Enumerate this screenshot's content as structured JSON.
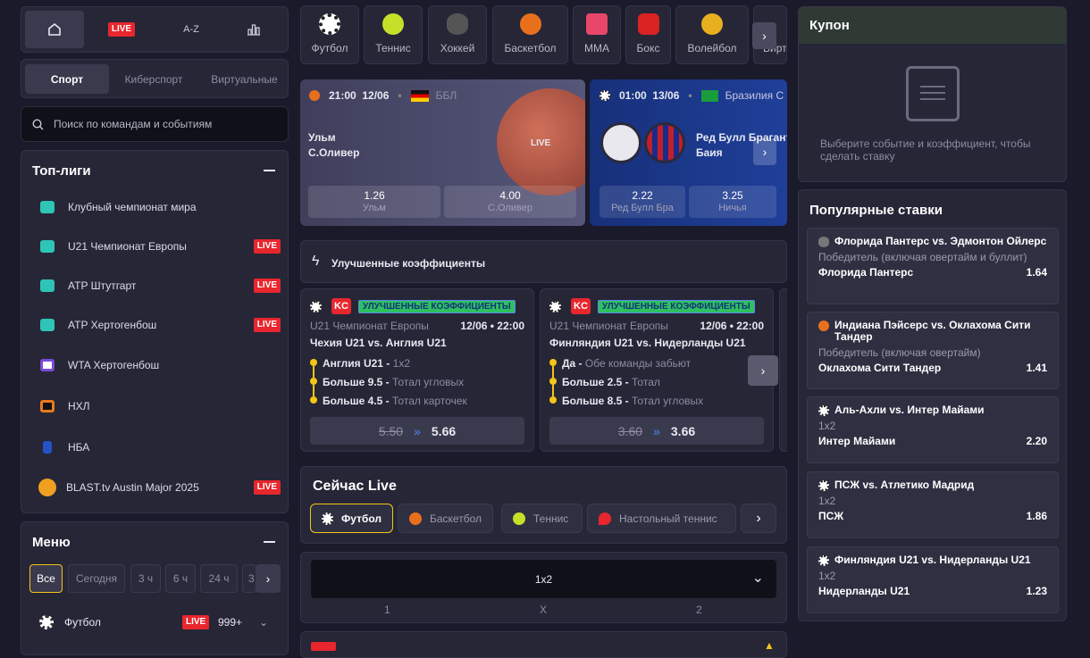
{
  "nav": {
    "live": "LIVE",
    "az": "A-Z"
  },
  "tabs": [
    "Спорт",
    "Киберспорт",
    "Виртуальные"
  ],
  "search": {
    "placeholder": "Поиск по командам и событиям"
  },
  "top_leagues": {
    "title": "Топ-лиги",
    "items": [
      {
        "name": "Клубный чемпионат мира",
        "live": false,
        "color": "#2ec4b6"
      },
      {
        "name": "U21 Чемпионат Европы",
        "live": true,
        "color": "#2ec4b6"
      },
      {
        "name": "ATP Штутгарт",
        "live": true,
        "color": "#2ec4b6"
      },
      {
        "name": "ATP Хертогенбош",
        "live": true,
        "color": "#2ec4b6"
      },
      {
        "name": "WTA Хертогенбош",
        "live": false,
        "color": "#7b4bd6"
      },
      {
        "name": "НХЛ",
        "live": false,
        "color": "#e87a1d"
      },
      {
        "name": "НБА",
        "live": false,
        "color": "#2453c7"
      },
      {
        "name": "BLAST.tv Austin Major 2025",
        "live": true,
        "color": "#f0a020"
      }
    ],
    "live_label": "LIVE"
  },
  "menu": {
    "title": "Меню",
    "chips": [
      "Все",
      "Сегодня",
      "3 ч",
      "6 ч",
      "24 ч",
      "3"
    ],
    "sport": {
      "name": "Футбол",
      "live": "LIVE",
      "count": "999+"
    }
  },
  "sports": [
    "Футбол",
    "Теннис",
    "Хоккей",
    "Баскетбол",
    "MMA",
    "Бокс",
    "Волейбол",
    "Вирту"
  ],
  "featured": [
    {
      "time": "21:00",
      "date": "12/06",
      "league": "ББЛ",
      "team1": "Ульм",
      "team2": "С.Оливер",
      "live": "LIVE",
      "odds": [
        {
          "v": "1.26",
          "n": "Ульм"
        },
        {
          "v": "4.00",
          "n": "С.Оливер"
        }
      ]
    },
    {
      "time": "01:00",
      "date": "13/06",
      "league": "Бразилия С",
      "team1": "Ред Булл Брагант",
      "team2": "Баия",
      "odds": [
        {
          "v": "2.22",
          "n": "Ред Булл Бра"
        },
        {
          "v": "3.25",
          "n": "Ничья"
        }
      ]
    }
  ],
  "boosted": {
    "title": "Улучшенные коэффициенты",
    "tag": "УЛУЧШЕННЫЕ КОЭФФИЦИЕНТЫ",
    "badge": "KC",
    "cards": [
      {
        "league": "U21 Чемпионат Европы",
        "datetime": "12/06 • 22:00",
        "match": "Чехия U21 vs. Англия U21",
        "lines": [
          {
            "b": "Англия U21 -",
            "m": "1x2"
          },
          {
            "b": "Больше 9.5 -",
            "m": "Тотал угловых"
          },
          {
            "b": "Больше 4.5 -",
            "m": "Тотал карточек"
          }
        ],
        "old": "5.50",
        "new": "5.66"
      },
      {
        "league": "U21 Чемпионат Европы",
        "datetime": "12/06 • 22:00",
        "match": "Финляндия U21 vs. Нидерланды U21",
        "lines": [
          {
            "b": "Да -",
            "m": "Обе команды забьют"
          },
          {
            "b": "Больше 2.5 -",
            "m": "Тотал"
          },
          {
            "b": "Больше 8.5 -",
            "m": "Тотал угловых"
          }
        ],
        "old": "3.60",
        "new": "3.66"
      }
    ]
  },
  "live_now": {
    "title": "Сейчас Live",
    "chips": [
      "Футбол",
      "Баскетбол",
      "Теннис",
      "Настольный теннис"
    ],
    "market": "1x2",
    "cols": [
      "1",
      "X",
      "2"
    ]
  },
  "coupon": {
    "title": "Купон",
    "empty": "Выберите событие и коэффициент, чтобы сделать ставку"
  },
  "popular": {
    "title": "Популярные ставки",
    "items": [
      {
        "match": "Флорида Пантерс vs. Эдмонтон Ойлерс",
        "market": "Победитель (включая овертайм и буллит)",
        "pick": "Флорида Пантерс",
        "odd": "1.64",
        "icon": "hockey"
      },
      {
        "match": "Индиана Пэйсерс vs. Оклахома Сити Тандер",
        "market": "Победитель (включая овертайм)",
        "pick": "Оклахома Сити Тандер",
        "odd": "1.41",
        "icon": "basketball"
      },
      {
        "match": "Аль-Ахли vs. Интер Майами",
        "market": "1x2",
        "pick": "Интер Майами",
        "odd": "2.20",
        "icon": "football"
      },
      {
        "match": "ПСЖ vs. Атлетико Мадрид",
        "market": "1x2",
        "pick": "ПСЖ",
        "odd": "1.86",
        "icon": "football"
      },
      {
        "match": "Финляндия U21 vs. Нидерланды U21",
        "market": "1x2",
        "pick": "Нидерланды U21",
        "odd": "1.23",
        "icon": "football"
      }
    ]
  }
}
